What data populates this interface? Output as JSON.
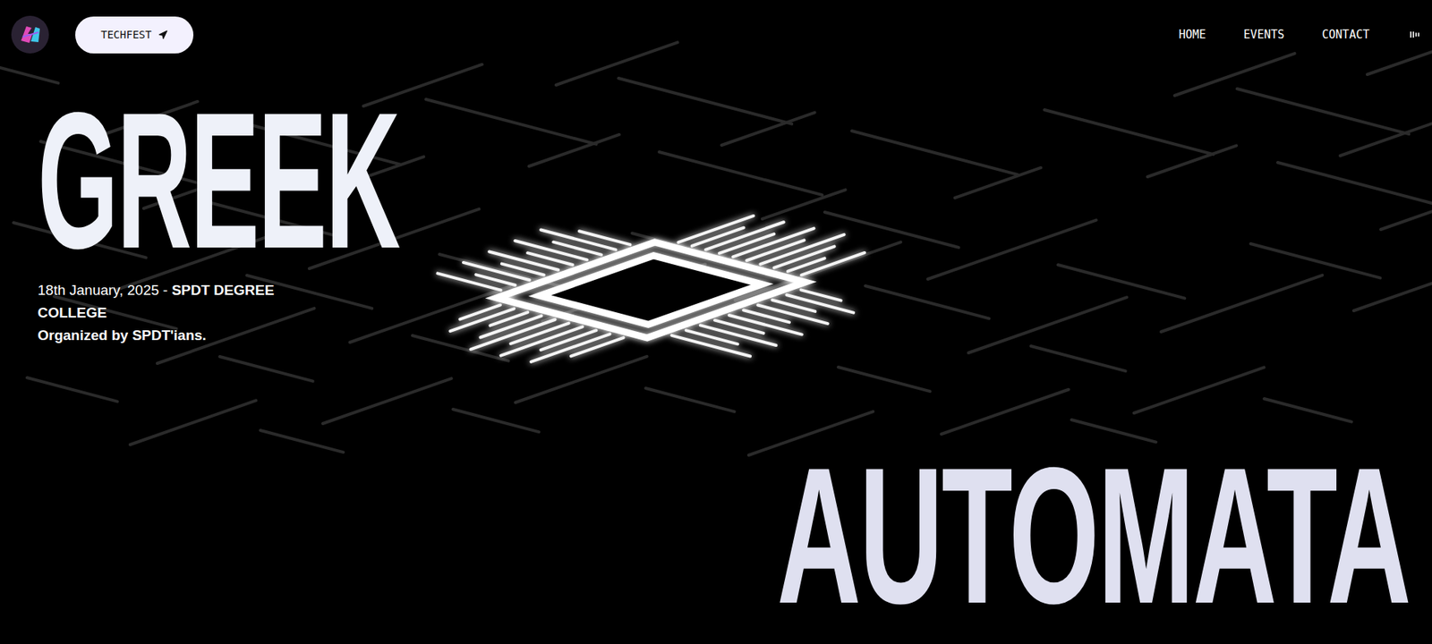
{
  "header": {
    "button": {
      "label": "TECHFEST"
    },
    "nav": [
      {
        "label": "HOME"
      },
      {
        "label": "EVENTS"
      },
      {
        "label": "CONTACT"
      }
    ]
  },
  "hero": {
    "title_top": "GREEK",
    "title_bottom": "AUTOMATA",
    "date": "18th January, 2025 - ",
    "venue": "SPDT DEGREE COLLEGE",
    "organizer": "Organized by SPDT'ians."
  }
}
